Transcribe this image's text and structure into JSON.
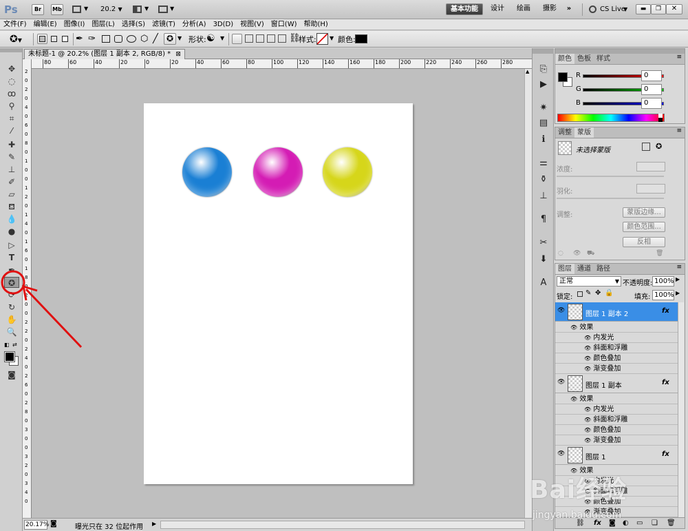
{
  "appbar": {
    "logo": "Ps",
    "br": "Br",
    "mb": "Mb",
    "zoom": "20.2",
    "workspaces": [
      "基本功能",
      "设计",
      "绘画",
      "摄影"
    ],
    "more": "»",
    "cslive": "CS Live"
  },
  "menu": [
    "文件(F)",
    "编辑(E)",
    "图像(I)",
    "图层(L)",
    "选择(S)",
    "滤镜(T)",
    "分析(A)",
    "3D(D)",
    "视图(V)",
    "窗口(W)",
    "帮助(H)"
  ],
  "options": {
    "shape_label": "形状:",
    "style_label": "样式:",
    "color_label": "颜色:",
    "color": "#000000"
  },
  "document": {
    "tab_title": "未标题-1 @ 20.2% (图层 1 副本 2, RGB/8) *",
    "balls": [
      {
        "name": "blue-sphere",
        "color": "#1a7fd4"
      },
      {
        "name": "magenta-sphere",
        "color": "#d41cb4"
      },
      {
        "name": "yellow-sphere",
        "color": "#d6d61a"
      }
    ],
    "ruler_top": [
      "80",
      "60",
      "40",
      "20",
      "0",
      "20",
      "40",
      "60",
      "80",
      "100",
      "120",
      "140",
      "160",
      "180",
      "200",
      "220",
      "240",
      "260",
      "280"
    ],
    "ruler_left": [
      "2",
      "0",
      "2",
      "0",
      "4",
      "0",
      "6",
      "0",
      "8",
      "0",
      "1",
      "0",
      "0",
      "1",
      "2",
      "0",
      "1",
      "4",
      "0",
      "1",
      "6",
      "0",
      "1",
      "8",
      "0",
      "2",
      "0",
      "0",
      "2",
      "2",
      "0",
      "2",
      "4",
      "0",
      "2",
      "6",
      "0",
      "2",
      "8",
      "0",
      "3",
      "0",
      "0",
      "3",
      "2",
      "0",
      "3",
      "4",
      "0"
    ]
  },
  "status": {
    "zoom": "20.17%",
    "message": "曝光只在 32 位起作用"
  },
  "color_panel": {
    "tabs": [
      "颜色",
      "色板",
      "样式"
    ],
    "channels": [
      {
        "label": "R",
        "value": "0"
      },
      {
        "label": "G",
        "value": "0"
      },
      {
        "label": "B",
        "value": "0"
      }
    ],
    "fg": "#000000",
    "bg": "#ffffff"
  },
  "mask_panel": {
    "tabs": [
      "调整",
      "蒙版"
    ],
    "title": "未选择蒙版",
    "density_label": "浓度:",
    "feather_label": "羽化:",
    "refine_label": "调整:",
    "buttons": [
      "蒙版边缘...",
      "颜色范围...",
      "反相"
    ]
  },
  "layers_panel": {
    "tabs": [
      "图层",
      "通道",
      "路径"
    ],
    "blend_mode": "正常",
    "opacity_label": "不透明度:",
    "opacity": "100%",
    "lock_label": "锁定:",
    "fill_label": "填充:",
    "fill": "100%",
    "layers": [
      {
        "name": "图层 1 副本 2",
        "selected": true,
        "effects_label": "效果",
        "effects": [
          "内发光",
          "斜面和浮雕",
          "颜色叠加",
          "渐变叠加"
        ]
      },
      {
        "name": "图层 1 副本",
        "selected": false,
        "effects_label": "效果",
        "effects": [
          "内发光",
          "斜面和浮雕",
          "颜色叠加",
          "渐变叠加"
        ]
      },
      {
        "name": "图层 1",
        "selected": false,
        "effects_label": "效果",
        "effects": [
          "内发光",
          "斜面和浮雕",
          "颜色叠加",
          "渐变叠加"
        ]
      }
    ],
    "fx": "fx"
  },
  "watermark": {
    "text": "Bai经验",
    "url": "jingyan.baidu.com"
  },
  "annotation_color": "#e01010"
}
